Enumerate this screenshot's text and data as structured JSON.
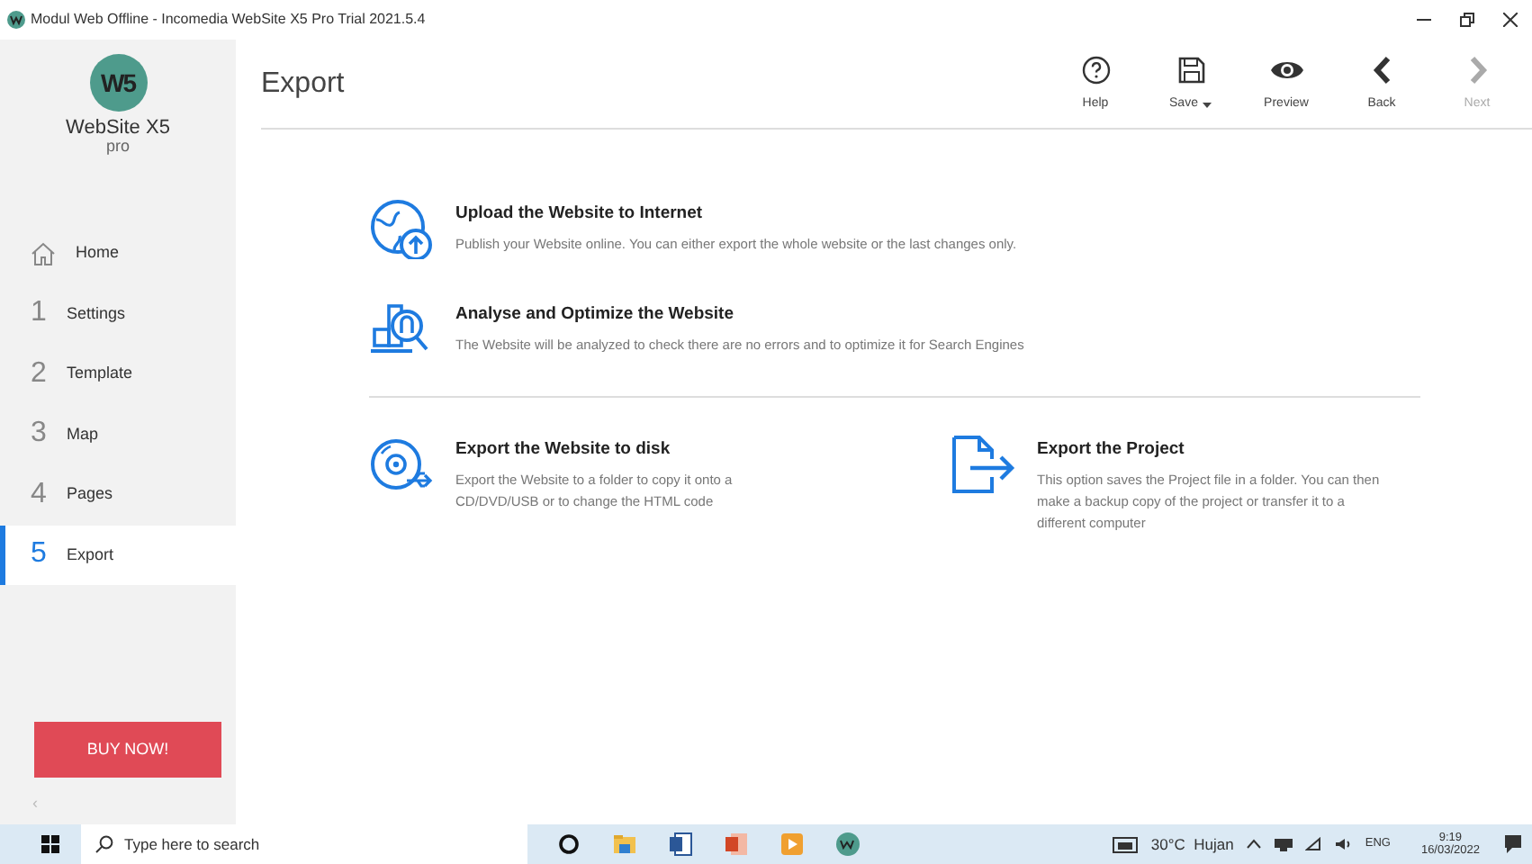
{
  "window": {
    "title": "Modul Web Offline - Incomedia WebSite X5 Pro Trial 2021.5.4"
  },
  "logo": {
    "mark": "W5",
    "name": "WebSite X5",
    "edition": "pro"
  },
  "sidebar": {
    "items": [
      {
        "kind": "icon",
        "label": "Home",
        "selected": false
      },
      {
        "kind": "number",
        "number": "1",
        "label": "Settings",
        "selected": false
      },
      {
        "kind": "number",
        "number": "2",
        "label": "Template",
        "selected": false
      },
      {
        "kind": "number",
        "number": "3",
        "label": "Map",
        "selected": false
      },
      {
        "kind": "number",
        "number": "4",
        "label": "Pages",
        "selected": false
      },
      {
        "kind": "number",
        "number": "5",
        "label": "Export",
        "selected": true
      }
    ],
    "buy_button": "BUY NOW!",
    "collapse": "‹"
  },
  "page": {
    "title": "Export"
  },
  "toolbar": [
    {
      "kind": "help",
      "label": "Help",
      "disabled": false,
      "dropdown": false
    },
    {
      "kind": "save",
      "label": "Save",
      "disabled": false,
      "dropdown": true
    },
    {
      "kind": "preview",
      "label": "Preview",
      "disabled": false,
      "dropdown": false
    },
    {
      "kind": "back",
      "label": "Back",
      "disabled": false,
      "dropdown": false
    },
    {
      "kind": "next",
      "label": "Next",
      "disabled": true,
      "dropdown": false
    }
  ],
  "sections": [
    {
      "kind": "rows",
      "options": [
        {
          "kind": "upload",
          "title": "Upload the Website to Internet",
          "description": "Publish your Website online. You can either export the whole website or the last changes only."
        },
        {
          "kind": "analyse",
          "title": "Analyse and Optimize the Website",
          "description": "The Website will be analyzed to check there are no errors and to optimize it for Search Engines"
        }
      ]
    },
    {
      "kind": "columns",
      "options": [
        {
          "kind": "disk",
          "title": "Export the Website to disk",
          "description": "Export the Website to a folder to copy it onto a CD/DVD/USB or to change the HTML code"
        },
        {
          "kind": "project",
          "title": "Export the Project",
          "description": "This option saves the Project file in a folder.  You can then make a backup copy of the project or transfer it to a different computer"
        }
      ]
    }
  ],
  "taskbar": {
    "search_placeholder": "Type here to search",
    "apps": [
      {
        "kind": "cortana"
      },
      {
        "kind": "explorer"
      },
      {
        "kind": "word"
      },
      {
        "kind": "powerpoint"
      },
      {
        "kind": "player"
      },
      {
        "kind": "websitex5"
      }
    ],
    "weather": "30°C  Hujan",
    "language": "ENG",
    "time": "9:19",
    "date": "16/03/2022"
  }
}
